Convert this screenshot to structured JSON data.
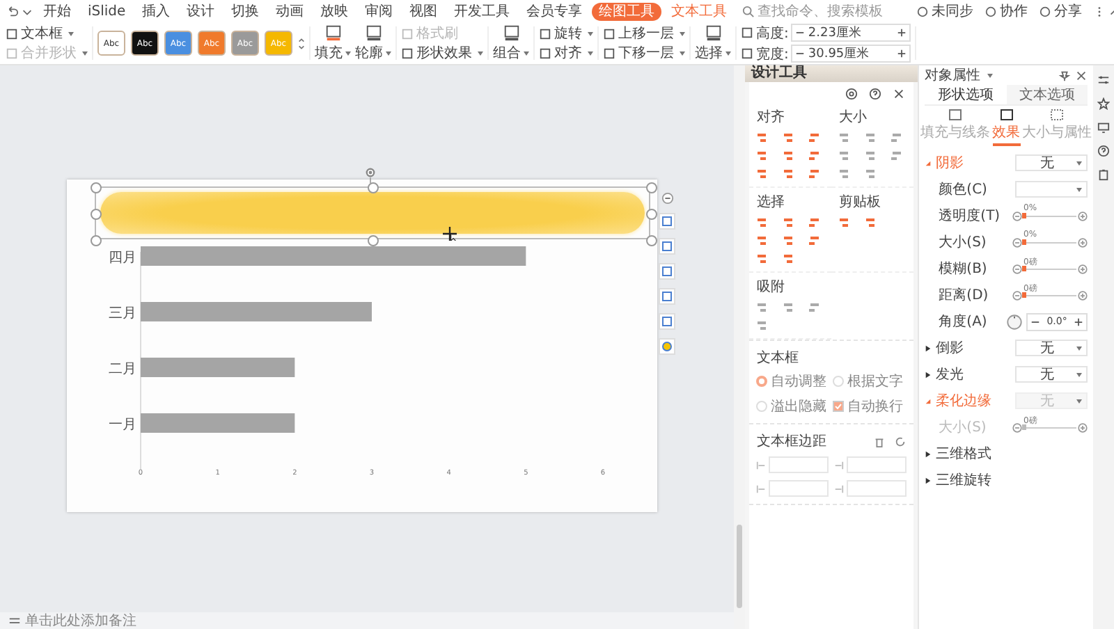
{
  "menu": {
    "tabs": [
      {
        "label": "开始",
        "selected": false,
        "kind": "normal"
      },
      {
        "label": "iSlide",
        "selected": false,
        "kind": "normal"
      },
      {
        "label": "插入",
        "selected": false,
        "kind": "normal"
      },
      {
        "label": "设计",
        "selected": false,
        "kind": "normal"
      },
      {
        "label": "切换",
        "selected": false,
        "kind": "normal"
      },
      {
        "label": "动画",
        "selected": false,
        "kind": "normal"
      },
      {
        "label": "放映",
        "selected": false,
        "kind": "normal"
      },
      {
        "label": "审阅",
        "selected": false,
        "kind": "normal"
      },
      {
        "label": "视图",
        "selected": false,
        "kind": "normal"
      },
      {
        "label": "开发工具",
        "selected": false,
        "kind": "normal"
      },
      {
        "label": "会员专享",
        "selected": false,
        "kind": "normal"
      },
      {
        "label": "绘图工具",
        "selected": true,
        "kind": "contextual"
      },
      {
        "label": "文本工具",
        "selected": false,
        "kind": "contextual"
      }
    ]
  },
  "search": {
    "placeholder": "查找命令、搜索模板"
  },
  "actions": [
    "未同步",
    "协作",
    "分享"
  ],
  "ribbon": [
    {
      "kind": "stack",
      "items": [
        {
          "label": "文本框",
          "dropdown": true,
          "disabled": false
        },
        {
          "label": "合并形状",
          "dropdown": true,
          "disabled": true
        }
      ]
    },
    {
      "kind": "gallery",
      "items": [
        {
          "label": "Abc",
          "color": "#ffffff"
        },
        {
          "label": "Abc",
          "color": "#111111"
        },
        {
          "label": "Abc",
          "color": "#4a8fe0"
        },
        {
          "label": "Abc",
          "color": "#f07a2b"
        },
        {
          "label": "Abc",
          "color": "#9a9a9a"
        },
        {
          "label": "Abc",
          "color": "#f5b800"
        }
      ]
    },
    {
      "kind": "big",
      "items": [
        {
          "label": "填充",
          "dropdown": true,
          "disabled": false
        },
        {
          "label": "轮廓",
          "dropdown": true,
          "disabled": false
        }
      ]
    },
    {
      "kind": "stack",
      "items": [
        {
          "label": "格式刷",
          "dropdown": false,
          "disabled": true
        },
        {
          "label": "形状效果",
          "dropdown": true,
          "disabled": false
        }
      ]
    },
    {
      "kind": "big",
      "items": [
        {
          "label": "组合",
          "dropdown": true,
          "disabled": false
        }
      ]
    },
    {
      "kind": "stack",
      "items": [
        {
          "label": "旋转",
          "dropdown": true,
          "disabled": false
        },
        {
          "label": "对齐",
          "dropdown": true,
          "disabled": false
        }
      ]
    },
    {
      "kind": "stack",
      "items": [
        {
          "label": "上移一层",
          "dropdown": true,
          "disabled": false
        },
        {
          "label": "下移一层",
          "dropdown": true,
          "disabled": false
        }
      ]
    },
    {
      "kind": "big",
      "items": [
        {
          "label": "选择",
          "dropdown": true,
          "disabled": false
        }
      ]
    },
    {
      "kind": "size",
      "items": [
        {
          "label": "高度:",
          "value": "2.23厘米"
        },
        {
          "label": "宽度:",
          "value": "30.95厘米"
        }
      ]
    }
  ],
  "slide": {
    "chart_data": {
      "type": "bar",
      "orientation": "horizontal",
      "categories": [
        "四月",
        "三月",
        "二月",
        "一月"
      ],
      "series": [
        {
          "color": "#a5a5a5",
          "values": [
            5,
            3,
            2,
            2
          ]
        }
      ],
      "xlim": [
        0,
        6
      ],
      "xticks": [
        0,
        1,
        2,
        3,
        4,
        5,
        6
      ]
    }
  },
  "notes": {
    "placeholder": "单击此处添加备注"
  },
  "design_panel": {
    "title": "设计工具",
    "sections": [
      {
        "title": "对齐"
      },
      {
        "title": "大小"
      },
      {
        "title": "选择"
      },
      {
        "title": "剪贴板"
      },
      {
        "title": "吸附"
      }
    ],
    "text_box": {
      "title": "文本框",
      "options": [
        {
          "kind": "radio",
          "label": "自动调整",
          "selected": true
        },
        {
          "kind": "radio",
          "label": "根据文字",
          "selected": false
        },
        {
          "kind": "radio",
          "label": "溢出隐藏",
          "selected": false
        },
        {
          "kind": "checkbox",
          "label": "自动换行",
          "checked": true
        }
      ]
    },
    "margins": {
      "title": "文本框边距"
    }
  },
  "object_panel": {
    "title": "对象属性",
    "tabs": [
      {
        "label": "形状选项",
        "selected": true
      },
      {
        "label": "文本选项",
        "selected": false
      }
    ],
    "subtabs": [
      {
        "label": "填充与线条",
        "selected": false
      },
      {
        "label": "效果",
        "selected": true
      },
      {
        "label": "大小与属性",
        "selected": false
      }
    ],
    "sections": [
      {
        "title": "阴影",
        "expanded": true,
        "value": "无",
        "rows": [
          {
            "kind": "dropdown",
            "label": "颜色(C)"
          },
          {
            "kind": "slider",
            "label": "透明度(T)",
            "reading": "0%",
            "level": 0,
            "disabled": false
          },
          {
            "kind": "slider",
            "label": "大小(S)",
            "reading": "0%",
            "level": 0,
            "disabled": false
          },
          {
            "kind": "slider",
            "label": "模糊(B)",
            "reading": "0磅",
            "level": 0,
            "disabled": false
          },
          {
            "kind": "slider",
            "label": "距离(D)",
            "reading": "0磅",
            "level": 0,
            "disabled": false
          },
          {
            "kind": "angle",
            "label": "角度(A)",
            "value": "0.0°"
          }
        ]
      },
      {
        "title": "倒影",
        "expanded": false,
        "value": "无"
      },
      {
        "title": "发光",
        "expanded": false,
        "value": "无"
      },
      {
        "title": "柔化边缘",
        "expanded": true,
        "disabled": true,
        "value": "无",
        "rows": [
          {
            "kind": "slider",
            "label": "大小(S)",
            "reading": "0磅",
            "level": 0,
            "disabled": true
          }
        ]
      },
      {
        "title": "三维格式",
        "expanded": false
      },
      {
        "title": "三维旋转",
        "expanded": false
      }
    ]
  }
}
